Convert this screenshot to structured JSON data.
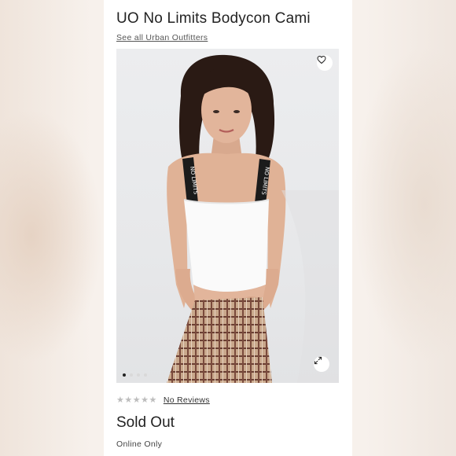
{
  "product": {
    "title": "UO No Limits Bodycon Cami",
    "brand_link": "See all Urban Outfitters",
    "strap_text": "NO LIMITS"
  },
  "gallery": {
    "favorite_icon": "heart-outline-icon",
    "expand_icon": "expand-arrows-icon",
    "image_count": 4,
    "active_index": 0
  },
  "rating": {
    "stars_display": "★★★★★",
    "reviews_label": "No Reviews"
  },
  "status": "Sold Out",
  "availability": "Online Only",
  "colors": {
    "text": "#222222",
    "muted_star": "#bdbdbd",
    "page_bg": "#ffffff"
  }
}
